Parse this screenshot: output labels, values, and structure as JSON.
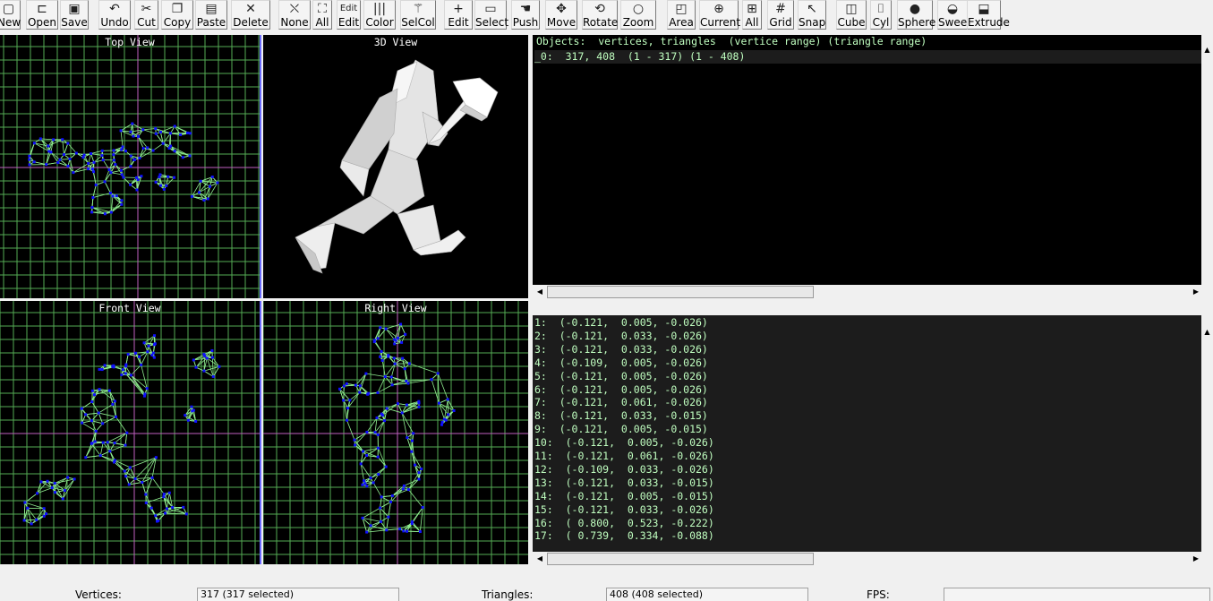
{
  "toolbar": {
    "buttons": [
      {
        "label": "New",
        "icon": "new-file-icon"
      },
      {
        "label": "Open",
        "icon": "open-folder-icon"
      },
      {
        "label": "Save",
        "icon": "save-disk-icon"
      },
      {
        "label": "Undo",
        "icon": "undo-icon"
      },
      {
        "label": "Cut",
        "icon": "scissors-icon"
      },
      {
        "label": "Copy",
        "icon": "copy-icon"
      },
      {
        "label": "Paste",
        "icon": "paste-icon"
      },
      {
        "label": "Delete",
        "icon": "delete-x-icon"
      },
      {
        "label": "None",
        "icon": "select-none-icon"
      },
      {
        "label": "All",
        "icon": "select-all-icon"
      },
      {
        "label": "Edit",
        "icon": "edit-icon",
        "icon_text": "Edit"
      },
      {
        "label": "Color",
        "icon": "color-bars-icon"
      },
      {
        "label": "SelCol",
        "icon": "wand-icon"
      },
      {
        "label": "Edit",
        "icon": "plus-icon"
      },
      {
        "label": "Select",
        "icon": "select-rect-icon"
      },
      {
        "label": "Push",
        "icon": "hand-icon"
      },
      {
        "label": "Move",
        "icon": "move-arrows-icon"
      },
      {
        "label": "Rotate",
        "icon": "rotate-icon"
      },
      {
        "label": "Zoom",
        "icon": "magnifier-icon"
      },
      {
        "label": "Area",
        "icon": "zoom-area-icon"
      },
      {
        "label": "Current",
        "icon": "zoom-current-icon"
      },
      {
        "label": "All",
        "icon": "zoom-all-icon"
      },
      {
        "label": "Grid",
        "icon": "grid-icon"
      },
      {
        "label": "Snap",
        "icon": "snap-icon"
      },
      {
        "label": "Cube",
        "icon": "cube-icon"
      },
      {
        "label": "Cyl",
        "icon": "cylinder-icon"
      },
      {
        "label": "Sphere",
        "icon": "sphere-icon"
      },
      {
        "label": "Sweep",
        "icon": "sweep-icon"
      },
      {
        "label": "Extrude",
        "icon": "extrude-icon"
      }
    ]
  },
  "views": {
    "top": "Top View",
    "three_d": "3D View",
    "front": "Front View",
    "right": "Right View"
  },
  "objects_panel": {
    "header": "Objects:  vertices, triangles  (vertice range) (triangle range)",
    "rows": [
      "_0:  317, 408  (1 - 317) (1 - 408)"
    ]
  },
  "vertices_panel": {
    "rows": [
      "1:  (-0.121,  0.005, -0.026)",
      "2:  (-0.121,  0.033, -0.026)",
      "3:  (-0.121,  0.033, -0.026)",
      "4:  (-0.109,  0.005, -0.026)",
      "5:  (-0.121,  0.005, -0.026)",
      "6:  (-0.121,  0.005, -0.026)",
      "7:  (-0.121,  0.061, -0.026)",
      "8:  (-0.121,  0.033, -0.015)",
      "9:  (-0.121,  0.005, -0.015)",
      "10:  (-0.121,  0.005, -0.026)",
      "11:  (-0.121,  0.061, -0.026)",
      "12:  (-0.109,  0.033, -0.026)",
      "13:  (-0.121,  0.033, -0.015)",
      "14:  (-0.121,  0.005, -0.015)",
      "15:  (-0.121,  0.033, -0.026)",
      "16:  ( 0.800,  0.523, -0.222)",
      "17:  ( 0.739,  0.334, -0.088)"
    ]
  },
  "status": {
    "vertices_label": "Vertices:",
    "vertices_value": "317  (317 selected)",
    "triangles_label": "Triangles:",
    "triangles_value": "408  (408 selected)",
    "fps_label": "FPS:",
    "fps_value": ""
  },
  "colors": {
    "grid": "#55ab55",
    "wire": "#90ee90",
    "vertex": "#1010ff",
    "axis": "#c060c0",
    "text_green": "#c0ffc0",
    "active_border": "#6a6aff"
  }
}
